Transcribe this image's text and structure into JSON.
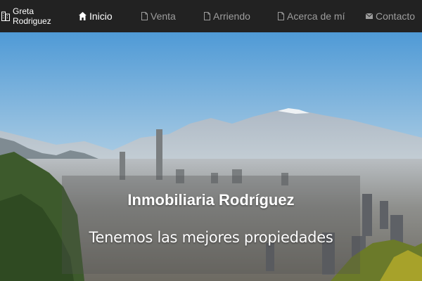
{
  "brand": {
    "name": "Greta Rodriguez",
    "icon": "building-icon"
  },
  "nav": {
    "items": [
      {
        "label": "Inicio",
        "icon": "home-icon",
        "active": true
      },
      {
        "label": "Venta",
        "icon": "file-icon",
        "active": false
      },
      {
        "label": "Arriendo",
        "icon": "file-icon",
        "active": false
      },
      {
        "label": "Acerca de mí",
        "icon": "file-icon",
        "active": false
      },
      {
        "label": "Contacto",
        "icon": "envelope-icon",
        "active": false
      }
    ]
  },
  "hero": {
    "title": "Inmobiliaria Rodríguez",
    "subtitle": "Tenemos las mejores propiedades"
  },
  "colors": {
    "navbar_bg": "#222222",
    "nav_active": "#ffffff",
    "nav_inactive": "#9d9d9d"
  }
}
